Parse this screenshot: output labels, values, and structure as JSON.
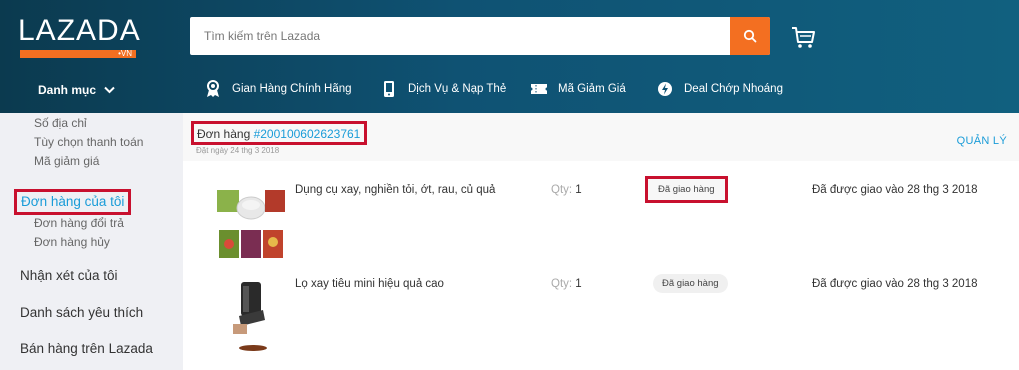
{
  "header": {
    "logo_text": "LAZADA",
    "logo_sub": "•VN",
    "search_placeholder": "Tìm kiếm trên Lazada",
    "category_label": "Danh mục",
    "nav": [
      {
        "label": "Gian Hàng Chính Hãng",
        "icon": "award-icon"
      },
      {
        "label": "Dịch Vụ & Nạp Thẻ",
        "icon": "phone-icon"
      },
      {
        "label": "Mã Giảm Giá",
        "icon": "ticket-icon"
      },
      {
        "label": "Deal Chớp Nhoáng",
        "icon": "flash-deal-icon"
      }
    ]
  },
  "sidebar": {
    "sub_top": [
      "Số địa chỉ",
      "Tùy chọn thanh toán",
      "Mã giảm giá"
    ],
    "active": "Đơn hàng của tôi",
    "sub_orders": [
      "Đơn hàng đổi trả",
      "Đơn hàng hủy"
    ],
    "main": [
      "Nhận xét của tôi",
      "Danh sách yêu thích",
      "Bán hàng trên Lazada"
    ]
  },
  "order": {
    "label": "Đơn hàng ",
    "id": "#200100602623761",
    "date": "Đặt ngày 24 thg 3 2018",
    "manage": "QUẢN LÝ"
  },
  "items": [
    {
      "name": "Dụng cụ xay, nghiền tỏi, ớt, rau, củ quả",
      "qty_label": "Qty:",
      "qty": "1",
      "status": "Đã giao hàng",
      "delivered": "Đã được giao vào 28 thg 3 2018"
    },
    {
      "name": "Lọ xay tiêu mini hiệu quả cao",
      "qty_label": "Qty:",
      "qty": "1",
      "status": "Đã giao hàng",
      "delivered": "Đã được giao vào 28 thg 3 2018"
    }
  ],
  "colors": {
    "accent": "#f36f21",
    "header": "#0f5273",
    "link": "#1a9cd8",
    "highlight": "#c8102e"
  }
}
